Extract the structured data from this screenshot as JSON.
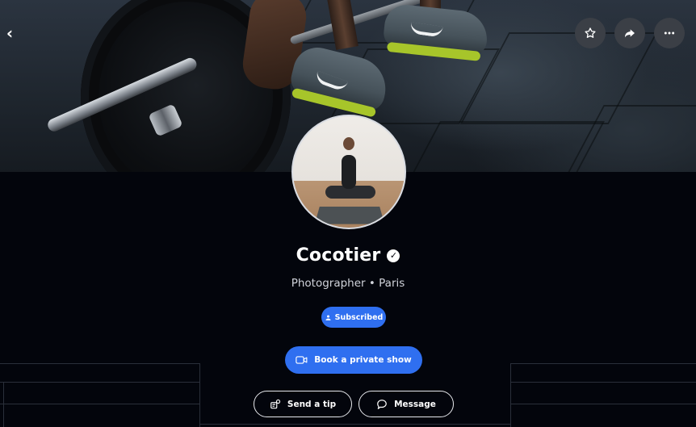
{
  "profile": {
    "name": "Cocotier",
    "subtitle": "Photographer • Paris",
    "verified": true
  },
  "actions": {
    "subscribed_label": "Subscribed",
    "book_label": "Book a private show",
    "tip_label": "Send a tip",
    "message_label": "Message"
  },
  "cover_actions": [
    {
      "name": "favorite",
      "icon": "star-icon"
    },
    {
      "name": "share",
      "icon": "share-icon"
    },
    {
      "name": "more",
      "icon": "more-icon"
    }
  ],
  "colors": {
    "accent": "#2f6ff0",
    "background": "#03050c",
    "cover_button": "#3b3f46"
  }
}
